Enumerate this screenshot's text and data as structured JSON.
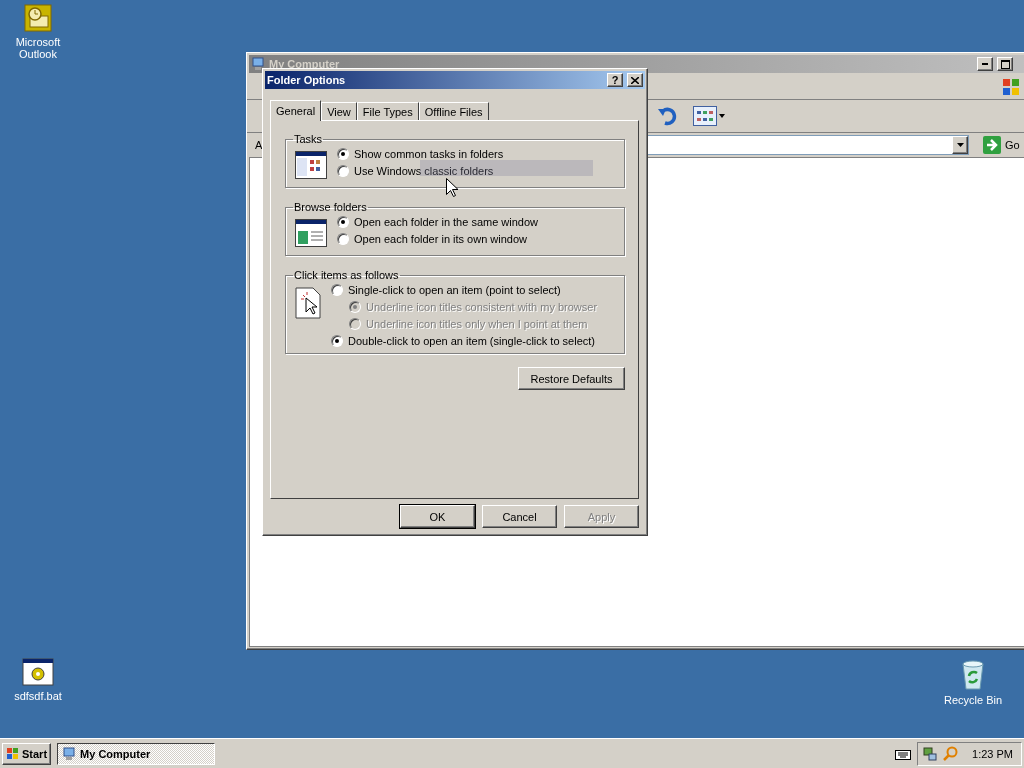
{
  "desktop_icons": [
    {
      "kind": "outlook",
      "label": "Microsoft Outlook"
    },
    {
      "kind": "batch",
      "label": "sdfsdf.bat"
    },
    {
      "kind": "recycle",
      "label": "Recycle Bin"
    }
  ],
  "explorer": {
    "title": "My Computer",
    "address_label": "A",
    "go_button": "Go"
  },
  "dialog": {
    "title": "Folder Options",
    "help_button": "?",
    "tabs": [
      {
        "label": "General",
        "selected": true
      },
      {
        "label": "View",
        "selected": false
      },
      {
        "label": "File Types",
        "selected": false
      },
      {
        "label": "Offline Files",
        "selected": false
      }
    ],
    "groups": [
      {
        "title": "Tasks",
        "kind": "tasks",
        "options": [
          {
            "label": "Show common tasks in folders",
            "selected": true,
            "disabled": false
          },
          {
            "label": "Use Windows classic folders",
            "selected": false,
            "disabled": false
          }
        ]
      },
      {
        "title": "Browse folders",
        "kind": "browse",
        "options": [
          {
            "label": "Open each folder in the same window",
            "selected": true,
            "disabled": false
          },
          {
            "label": "Open each folder in its own window",
            "selected": false,
            "disabled": false
          }
        ]
      },
      {
        "title": "Click items as follows",
        "kind": "click",
        "options": [
          {
            "label": "Single-click to open an item (point to select)",
            "selected": false,
            "disabled": false,
            "children": [
              {
                "label": "Underline icon titles consistent with my browser",
                "selected": true,
                "disabled": true
              },
              {
                "label": "Underline icon titles only when I point at them",
                "selected": false,
                "disabled": true
              }
            ]
          },
          {
            "label": "Double-click to open an item (single-click to select)",
            "selected": true,
            "disabled": false
          }
        ]
      }
    ],
    "restore_button": "Restore Defaults",
    "buttons": [
      {
        "label": "OK",
        "disabled": false
      },
      {
        "label": "Cancel",
        "disabled": false
      },
      {
        "label": "Apply",
        "disabled": true
      }
    ]
  },
  "taskbar": {
    "start": "Start",
    "tasks": [
      {
        "label": "My Computer",
        "selected": true
      }
    ],
    "clock": "1:23 PM"
  }
}
